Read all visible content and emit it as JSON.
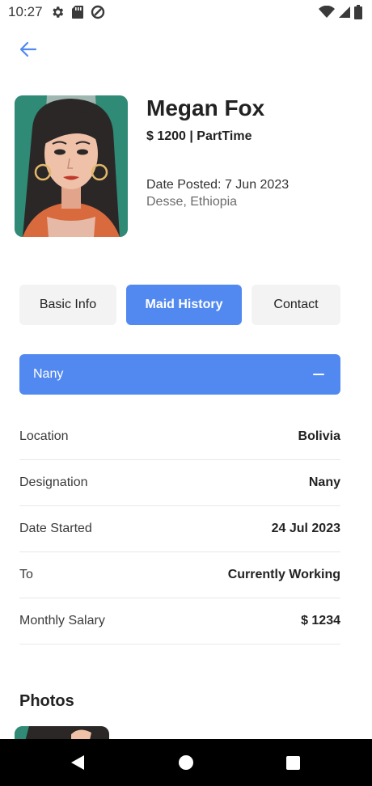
{
  "status_bar": {
    "time": "10:27",
    "left_icons": [
      "settings-icon",
      "sd-card-icon",
      "data-saver-icon"
    ],
    "right_icons": [
      "wifi-icon",
      "signal-icon",
      "battery-icon"
    ]
  },
  "header": {
    "back_icon": "arrow-left-icon",
    "accent_color": "#5289f0"
  },
  "profile": {
    "name": "Megan Fox",
    "salary_line": "$ 1200 | PartTime",
    "date_posted": "Date Posted: 7 Jun 2023",
    "location": "Desse, Ethiopia"
  },
  "tabs": [
    {
      "label": "Basic Info",
      "active": false
    },
    {
      "label": "Maid History",
      "active": true
    },
    {
      "label": "Contact",
      "active": false
    }
  ],
  "history": {
    "title": "Nany",
    "expanded": true,
    "rows": [
      {
        "label": "Location",
        "value": "Bolivia"
      },
      {
        "label": "Designation",
        "value": "Nany"
      },
      {
        "label": "Date Started",
        "value": "24 Jul 2023"
      },
      {
        "label": "To",
        "value": "Currently Working"
      },
      {
        "label": "Monthly Salary",
        "value": "$ 1234"
      }
    ]
  },
  "photos": {
    "title": "Photos"
  },
  "nav_bar": {
    "icons": [
      "nav-back-icon",
      "nav-home-icon",
      "nav-recents-icon"
    ]
  }
}
